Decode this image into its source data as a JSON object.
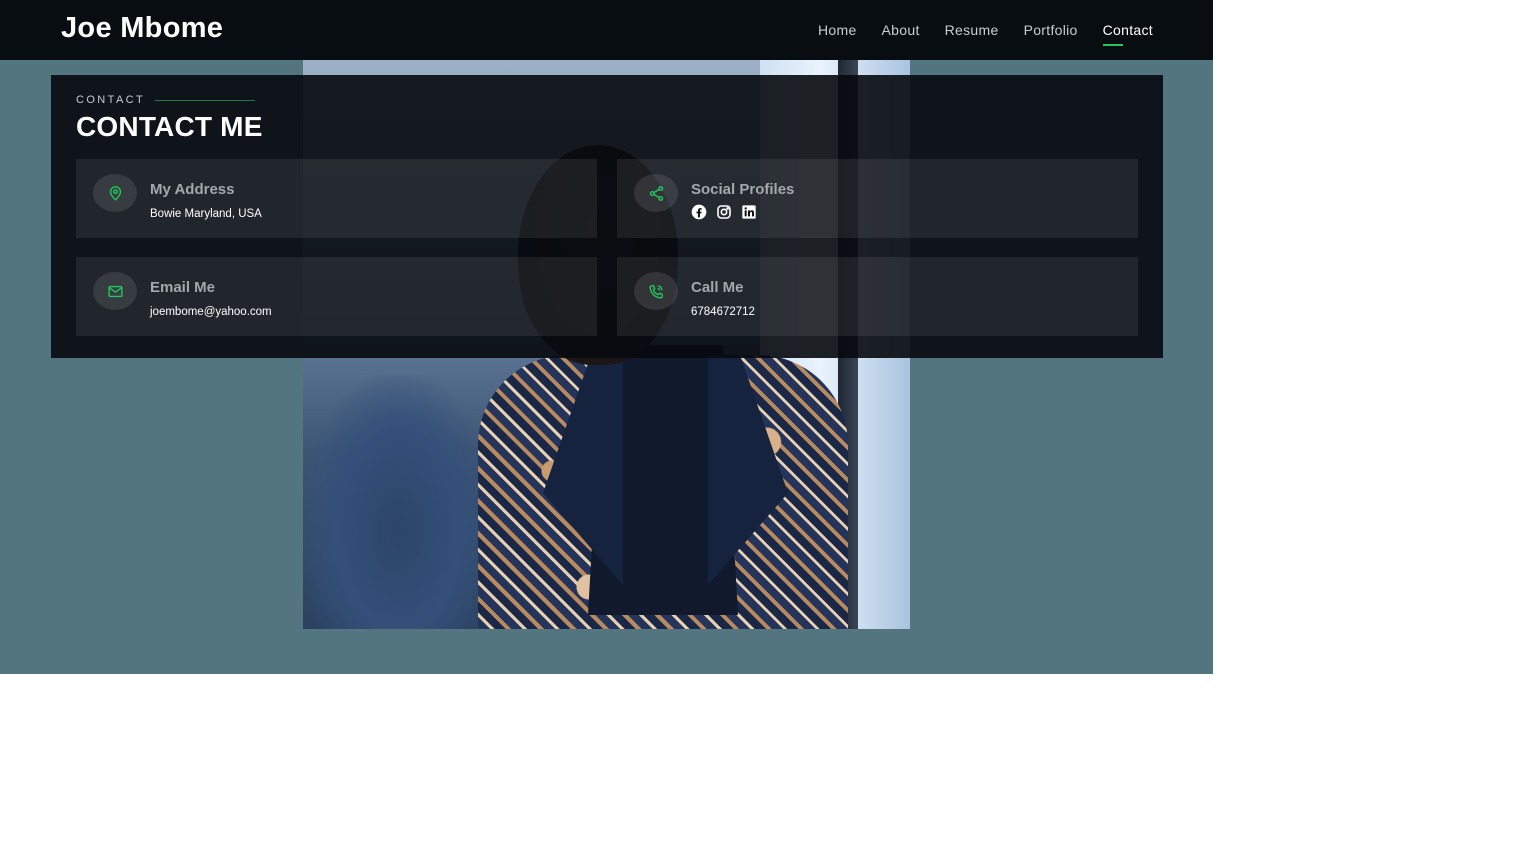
{
  "brand": "Joe Mbome",
  "nav": {
    "items": [
      "Home",
      "About",
      "Resume",
      "Portfolio",
      "Contact"
    ],
    "active": "Contact"
  },
  "section": {
    "kicker": "CONTACT",
    "title": "CONTACT ME"
  },
  "cards": {
    "address": {
      "title": "My Address",
      "text": "Bowie Maryland, USA",
      "icon": "map-pin-icon"
    },
    "social": {
      "title": "Social Profiles",
      "icons": [
        "facebook-icon",
        "instagram-icon",
        "linkedin-icon"
      ]
    },
    "email": {
      "title": "Email Me",
      "text": "joembome@yahoo.com",
      "icon": "mail-icon"
    },
    "phone": {
      "title": "Call Me",
      "text": "6784672712",
      "icon": "phone-icon"
    }
  },
  "colors": {
    "accent": "#22c55e",
    "header_bg": "#080d11",
    "page_bg": "#537580"
  }
}
